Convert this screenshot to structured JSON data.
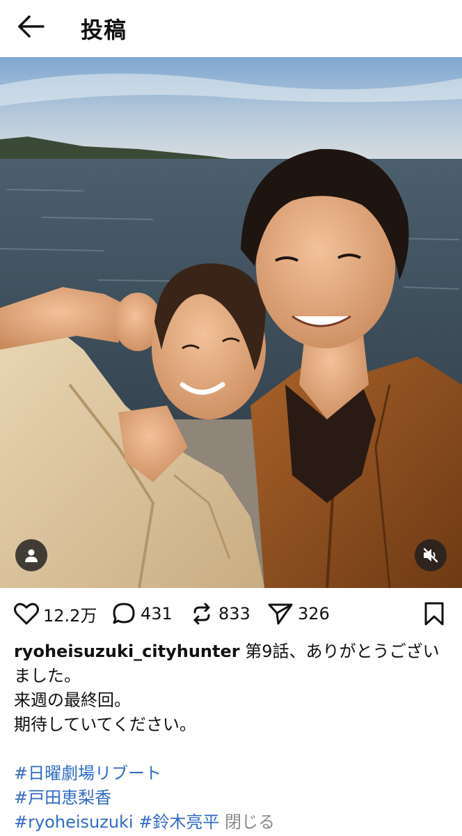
{
  "header": {
    "title": "投稿",
    "back_icon": "arrow-left-icon"
  },
  "media": {
    "user_tag_icon": "person-icon",
    "mute_icon": "volume-off-icon"
  },
  "actions": {
    "likes": "12.2万",
    "comments": "431",
    "reposts": "833",
    "shares": "326",
    "like_icon": "heart-icon",
    "comment_icon": "speech-bubble-icon",
    "repost_icon": "repost-icon",
    "share_icon": "send-icon",
    "save_icon": "bookmark-icon"
  },
  "caption": {
    "username": "ryoheisuzuki_cityhunter",
    "line1": " 第9話、ありがとうござい",
    "line2": "ました。",
    "line3": "来週の最終回。",
    "line4": "期待していてください。",
    "hashtags": [
      "#日曜劇場リブート",
      "#戸田恵梨香",
      "#ryoheisuzuki",
      "#鈴木亮平"
    ],
    "close_label": "閉じる"
  },
  "colors": {
    "hashtag": "#2f6bc7",
    "close": "#8a8a8a",
    "text": "#111111"
  }
}
